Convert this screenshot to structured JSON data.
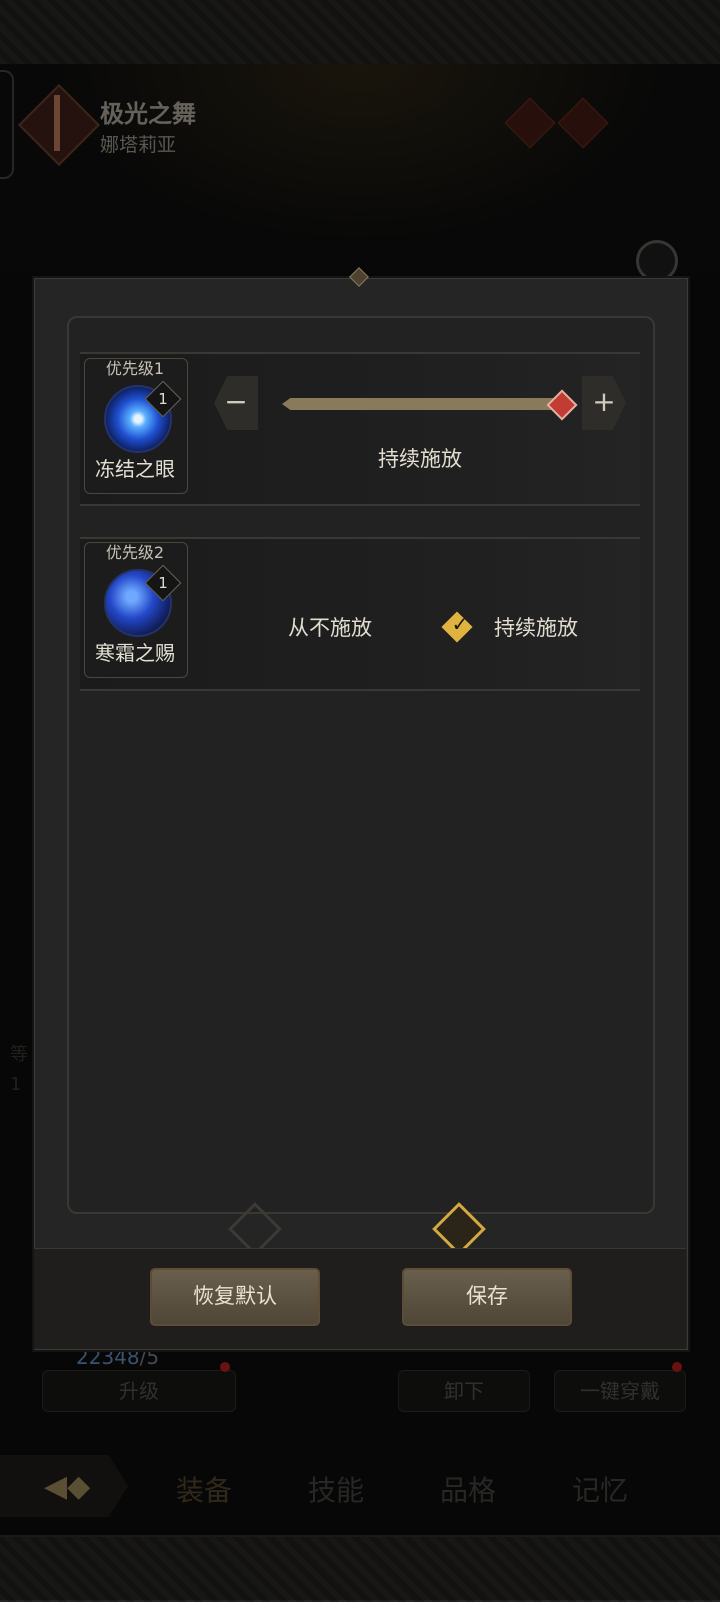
{
  "hero": {
    "name": "极光之舞",
    "subtitle": "娜塔莉亚"
  },
  "background": {
    "currency_value": "22348",
    "currency_limit": "/5",
    "upgrade_label": "升级",
    "unequip_label": "卸下",
    "equip_all_label": "一键穿戴",
    "stat_glyphs": [
      "等",
      "1"
    ]
  },
  "tabs": [
    {
      "label": "装备",
      "active": true
    },
    {
      "label": "技能",
      "active": false
    },
    {
      "label": "品格",
      "active": false
    },
    {
      "label": "记忆",
      "active": false
    }
  ],
  "dialog": {
    "skills": [
      {
        "priority": "优先级1",
        "level": "1",
        "name": "冻结之眼",
        "control": "slider",
        "slider_value_fraction": 1.0,
        "mode_label": "持续施放"
      },
      {
        "priority": "优先级2",
        "level": "1",
        "name": "寒霜之赐",
        "control": "toggle",
        "options": [
          {
            "label": "从不施放",
            "selected": false
          },
          {
            "label": "持续施放",
            "selected": true
          }
        ]
      }
    ],
    "minus_symbol": "−",
    "plus_symbol": "+",
    "buttons": {
      "reset": "恢复默认",
      "save": "保存"
    }
  },
  "colors": {
    "accent_gold": "#d4a940",
    "slider_handle": "#c23b34",
    "button_fill": "#5e5444"
  }
}
